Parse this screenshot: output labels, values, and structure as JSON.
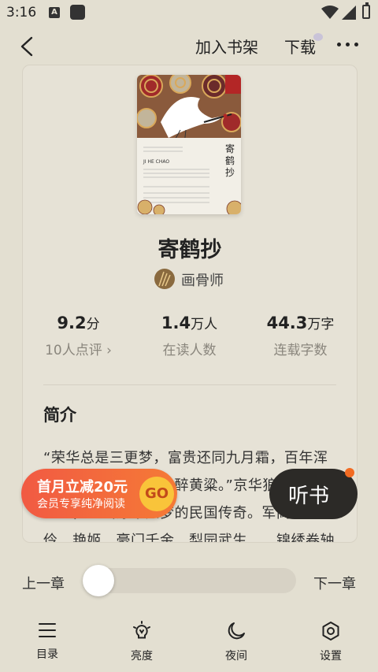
{
  "status_bar": {
    "time": "3:16",
    "a_icon": "A"
  },
  "nav": {
    "add_to_shelf": "加入书架",
    "download": "下载"
  },
  "book": {
    "title": "寄鹤抄",
    "author": "画骨师",
    "cover_title": "寄鹤抄",
    "cover_pinyin": "JI HE CHAO"
  },
  "stats": [
    {
      "value": "9.2",
      "unit": "分",
      "label": "10人点评 ›"
    },
    {
      "value": "1.4",
      "unit": "万人",
      "label": "在读人数"
    },
    {
      "value": "44.3",
      "unit": "万字",
      "label": "连载字数"
    }
  ],
  "intro": {
    "heading": "简介",
    "text": "“荣华总是三更梦，富贵还同九月霜，百年浑似醉，是非都付梦，醉黄粱。”京华狼烟，滚滚红尘，一出浮华如梦的民国传奇。军阀、名伶、艳姬、豪门千金、梨园武生……锦绣卷轴"
  },
  "promo": {
    "line1": "首月立减20元",
    "line2": "会员专享纯净阅读",
    "go": "GO"
  },
  "listen": {
    "label": "听书"
  },
  "chapter": {
    "prev": "上一章",
    "next": "下一章",
    "progress": 0.0
  },
  "tabs": [
    {
      "label": "目录",
      "icon": "list-icon"
    },
    {
      "label": "亮度",
      "icon": "brightness-icon"
    },
    {
      "label": "夜间",
      "icon": "moon-icon"
    },
    {
      "label": "设置",
      "icon": "settings-icon"
    }
  ],
  "colors": {
    "background": "#e3dfd1",
    "promo": "#f15a43",
    "go": "#f9c43a",
    "listen": "#2c2a27",
    "accent_dot": "#f26b22"
  }
}
